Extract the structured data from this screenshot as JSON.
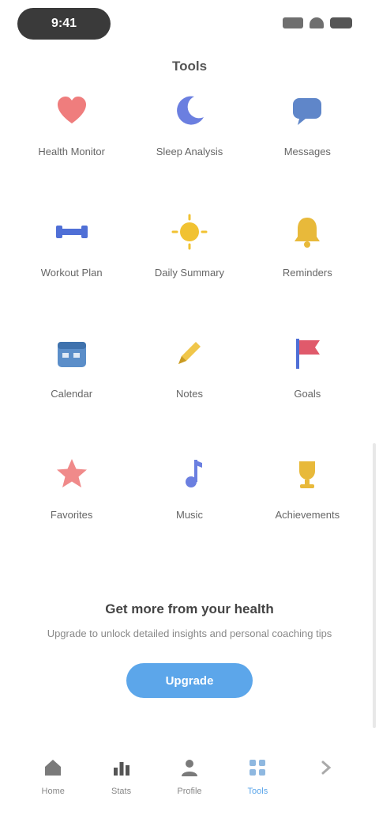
{
  "status_bar": {
    "time": "9:41"
  },
  "section_title": "Tools",
  "apps": [
    {
      "label": "Health Monitor",
      "icon": "heart-icon",
      "color": "#ef7d7d"
    },
    {
      "label": "Sleep Analysis",
      "icon": "moon-icon",
      "color": "#6b7fe0"
    },
    {
      "label": "Messages",
      "icon": "chat-icon",
      "color": "#5f86c9"
    },
    {
      "label": "Workout Plan",
      "icon": "dumbbell-icon",
      "color": "#4f6fd6"
    },
    {
      "label": "Daily Summary",
      "icon": "sun-icon",
      "color": "#f1c232"
    },
    {
      "label": "Reminders",
      "icon": "bell-icon",
      "color": "#e8b93a"
    },
    {
      "label": "Calendar",
      "icon": "calendar-icon",
      "color": "#5b8ec9"
    },
    {
      "label": "Notes",
      "icon": "pencil-icon",
      "color": "#f0c64a"
    },
    {
      "label": "Goals",
      "icon": "flag-icon",
      "color": "#e05a6b"
    },
    {
      "label": "Favorites",
      "icon": "star-icon",
      "color": "#f08a8a"
    },
    {
      "label": "Music",
      "icon": "music-icon",
      "color": "#6b7fe0"
    },
    {
      "label": "Achievements",
      "icon": "trophy-icon",
      "color": "#e8b93a"
    }
  ],
  "promo": {
    "title": "Get more from your health",
    "subtitle": "Upgrade to unlock detailed insights and personal coaching tips",
    "button_label": "Upgrade"
  },
  "tabs": [
    {
      "label": "Home",
      "icon": "home-icon",
      "active": false
    },
    {
      "label": "Stats",
      "icon": "chart-icon",
      "active": false
    },
    {
      "label": "Profile",
      "icon": "person-icon",
      "active": false
    },
    {
      "label": "Tools",
      "icon": "grid-icon",
      "active": true
    },
    {
      "label": "",
      "icon": "chevron-right-icon",
      "active": false
    }
  ]
}
